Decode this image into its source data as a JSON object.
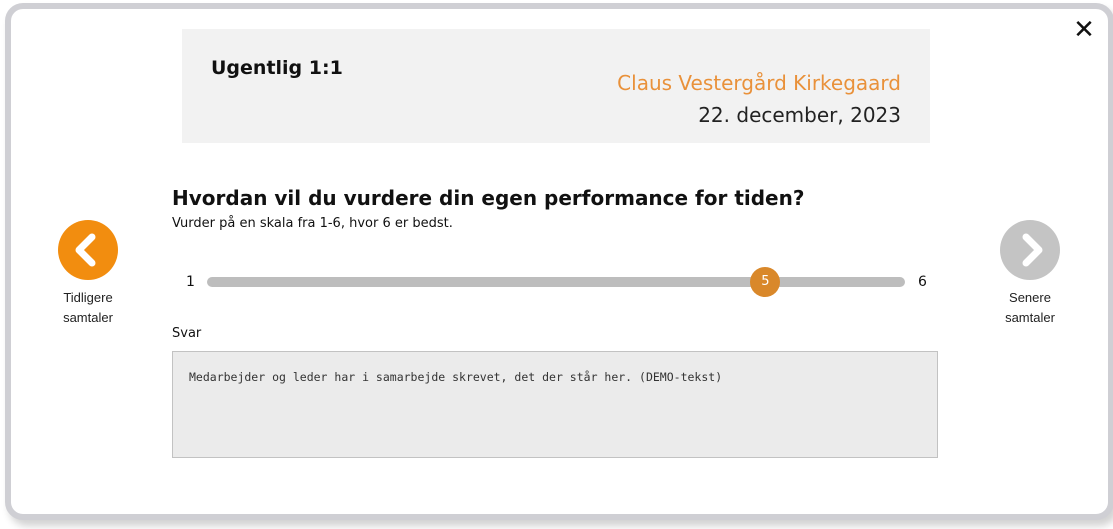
{
  "dialog": {
    "close_label": "✕"
  },
  "header": {
    "title": "Ugentlig 1:1",
    "person_name": "Claus Vestergård Kirkegaard",
    "date": "22. december, 2023"
  },
  "question": {
    "title": "Hvordan vil du vurdere din egen performance for tiden?",
    "subtitle": "Vurder på en skala fra 1-6, hvor 6 er bedst."
  },
  "rating": {
    "min_label": "1",
    "max_label": "6",
    "min": 1,
    "max": 6,
    "value": 5,
    "value_label": "5"
  },
  "answer": {
    "label": "Svar",
    "value": "Medarbejder og leder har i samarbejde skrevet, det der står her. (DEMO-tekst)"
  },
  "nav": {
    "prev_label_line1": "Tidligere",
    "prev_label_line2": "samtaler",
    "next_label_line1": "Senere",
    "next_label_line2": "samtaler"
  },
  "colors": {
    "accent": "#f28d0f",
    "name_text": "#e9913a",
    "slider_thumb": "#d9882a",
    "disabled": "#c4c4c4"
  }
}
